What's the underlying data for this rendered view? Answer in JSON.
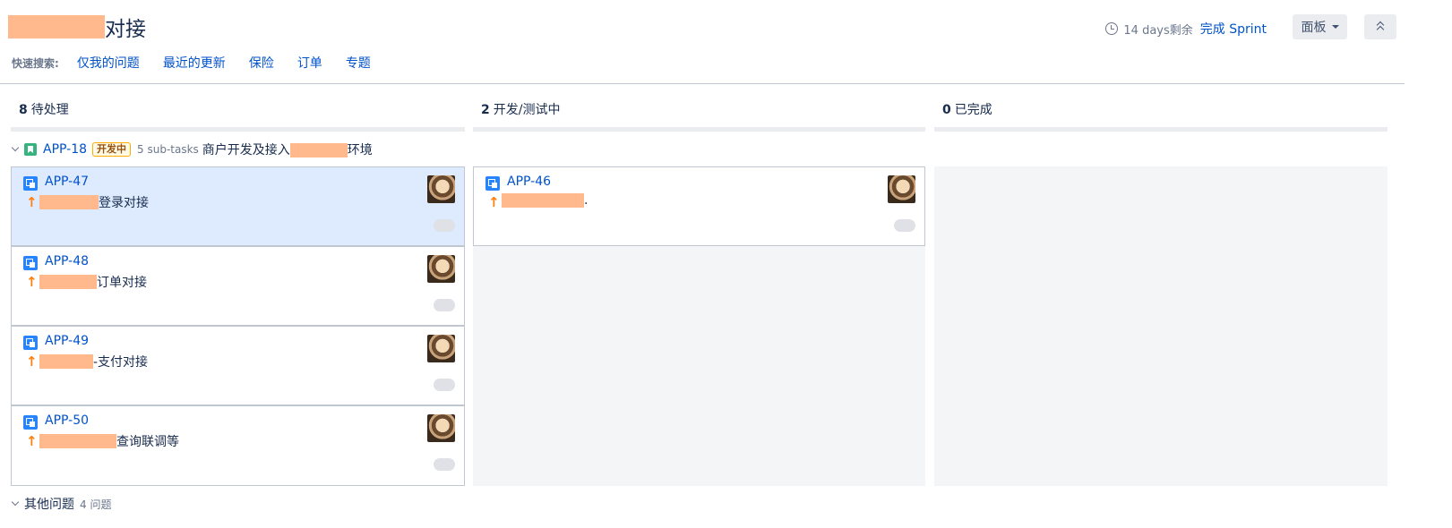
{
  "header": {
    "title_suffix": "对接",
    "remaining": "14 days剩余",
    "complete_sprint": "完成 Sprint",
    "board_menu": "面板"
  },
  "quick_filters": {
    "label": "快速搜索:",
    "items": [
      "仅我的问题",
      "最近的更新",
      "保险",
      "订单",
      "专题"
    ]
  },
  "columns": [
    {
      "count": "8",
      "name": "待处理"
    },
    {
      "count": "2",
      "name": "开发/测试中"
    },
    {
      "count": "0",
      "name": "已完成"
    }
  ],
  "swimlane": {
    "key": "APP-18",
    "status": "开发中",
    "subtasks": "5 sub-tasks",
    "summary_prefix": "商户开发及接入",
    "summary_suffix": "环境"
  },
  "cards": {
    "todo": [
      {
        "key": "APP-47",
        "summary_suffix": "登录对接",
        "selected": true
      },
      {
        "key": "APP-48",
        "summary_suffix": "订单对接"
      },
      {
        "key": "APP-49",
        "summary_suffix": "-支付对接"
      },
      {
        "key": "APP-50",
        "summary_suffix": " 查询联调等"
      }
    ],
    "in_progress": [
      {
        "key": "APP-46",
        "summary_suffix": "."
      }
    ]
  },
  "other_issues": {
    "label": "其他问题",
    "count": "4 问题"
  },
  "colors": {
    "link": "#0052cc",
    "selected_card": "#deebff",
    "priority": "#ff7f0e",
    "story": "#36b37e",
    "subtask": "#2684ff"
  }
}
